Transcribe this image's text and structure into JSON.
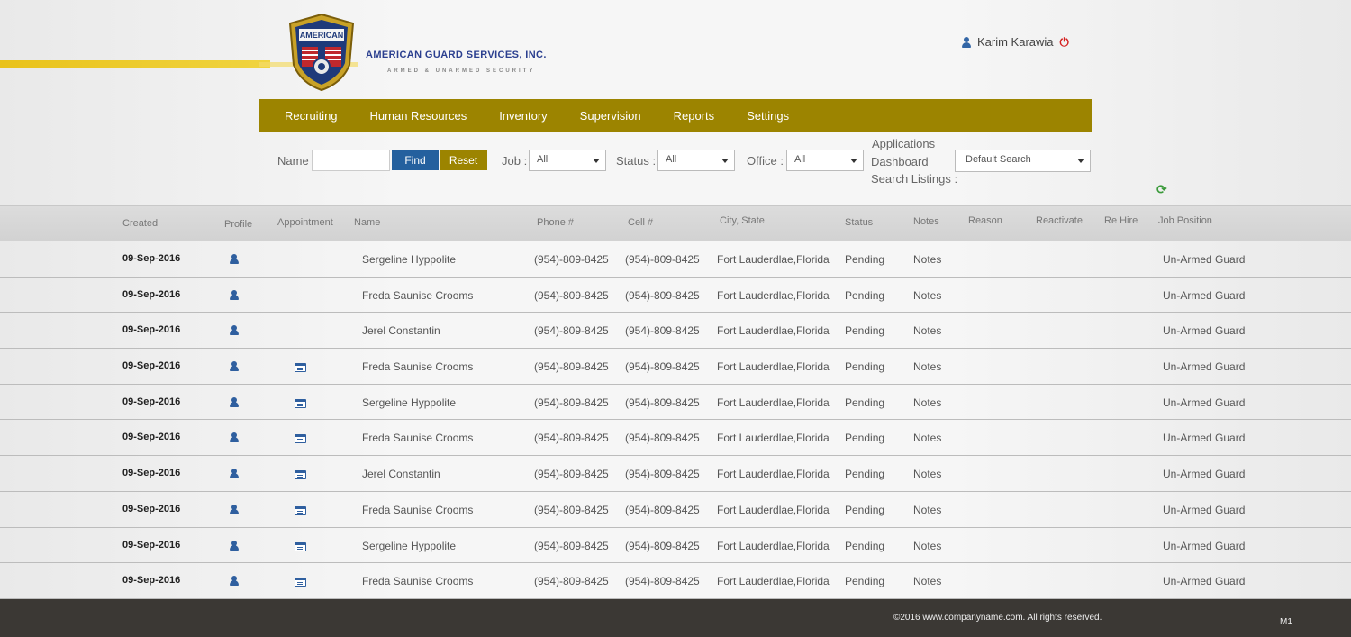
{
  "header": {
    "company_name": "AMERICAN GUARD SERVICES, INC.",
    "company_tagline": "ARMED & UNARMED SECURITY",
    "logo_text": "AMERICAN",
    "user_name": "Karim Karawia"
  },
  "nav": {
    "items": [
      "Recruiting",
      "Human Resources",
      "Inventory",
      "Supervision",
      "Reports",
      "Settings"
    ]
  },
  "filters": {
    "name_label": "Name",
    "name_value": "",
    "find_label": "Find",
    "reset_label": "Reset",
    "job_label": "Job :",
    "job_value": "All",
    "status_label": "Status :",
    "status_value": "All",
    "office_label": "Office :",
    "office_value": "All",
    "apps_label_1": "Applications",
    "apps_label_2": "Dashboard",
    "apps_label_3": "Search Listings :",
    "search_value": "Default Search"
  },
  "table": {
    "headers": [
      "Created",
      "Profile",
      "Appointment",
      "Name",
      "Phone #",
      "Cell #",
      "City, State",
      "Status",
      "Notes",
      "Reason",
      "Reactivate",
      "Re Hire",
      "Job Position"
    ],
    "rows": [
      {
        "created": "09-Sep-2016",
        "appointment": false,
        "name": "Sergeline Hyppolite",
        "phone": "(954)-809-8425",
        "cell": "(954)-809-8425",
        "city": "Fort Lauderdlae,Florida",
        "status": "Pending",
        "notes": "Notes",
        "job": "Un-Armed Guard"
      },
      {
        "created": "09-Sep-2016",
        "appointment": false,
        "name": "Freda Saunise Crooms",
        "phone": "(954)-809-8425",
        "cell": "(954)-809-8425",
        "city": "Fort Lauderdlae,Florida",
        "status": "Pending",
        "notes": "Notes",
        "job": "Un-Armed Guard"
      },
      {
        "created": "09-Sep-2016",
        "appointment": false,
        "name": "Jerel Constantin",
        "phone": "(954)-809-8425",
        "cell": "(954)-809-8425",
        "city": "Fort Lauderdlae,Florida",
        "status": "Pending",
        "notes": "Notes",
        "job": "Un-Armed Guard"
      },
      {
        "created": "09-Sep-2016",
        "appointment": true,
        "name": "Freda Saunise Crooms",
        "phone": "(954)-809-8425",
        "cell": "(954)-809-8425",
        "city": "Fort Lauderdlae,Florida",
        "status": "Pending",
        "notes": "Notes",
        "job": "Un-Armed Guard"
      },
      {
        "created": "09-Sep-2016",
        "appointment": true,
        "name": "Sergeline Hyppolite",
        "phone": "(954)-809-8425",
        "cell": "(954)-809-8425",
        "city": "Fort Lauderdlae,Florida",
        "status": "Pending",
        "notes": "Notes",
        "job": "Un-Armed Guard"
      },
      {
        "created": "09-Sep-2016",
        "appointment": true,
        "name": "Freda Saunise Crooms",
        "phone": "(954)-809-8425",
        "cell": "(954)-809-8425",
        "city": "Fort Lauderdlae,Florida",
        "status": "Pending",
        "notes": "Notes",
        "job": "Un-Armed Guard"
      },
      {
        "created": "09-Sep-2016",
        "appointment": true,
        "name": "Jerel Constantin",
        "phone": "(954)-809-8425",
        "cell": "(954)-809-8425",
        "city": "Fort Lauderdlae,Florida",
        "status": "Pending",
        "notes": "Notes",
        "job": "Un-Armed Guard"
      },
      {
        "created": "09-Sep-2016",
        "appointment": true,
        "name": "Freda Saunise Crooms",
        "phone": "(954)-809-8425",
        "cell": "(954)-809-8425",
        "city": "Fort Lauderdlae,Florida",
        "status": "Pending",
        "notes": "Notes",
        "job": "Un-Armed Guard"
      },
      {
        "created": "09-Sep-2016",
        "appointment": true,
        "name": "Sergeline Hyppolite",
        "phone": "(954)-809-8425",
        "cell": "(954)-809-8425",
        "city": "Fort Lauderdlae,Florida",
        "status": "Pending",
        "notes": "Notes",
        "job": "Un-Armed Guard"
      },
      {
        "created": "09-Sep-2016",
        "appointment": true,
        "name": "Freda Saunise Crooms",
        "phone": "(954)-809-8425",
        "cell": "(954)-809-8425",
        "city": "Fort Lauderdlae,Florida",
        "status": "Pending",
        "notes": "Notes",
        "job": "Un-Armed Guard"
      }
    ]
  },
  "footer": {
    "copyright": "©2016 www.companyname.com. All rights reserved.",
    "version": "M1"
  },
  "colors": {
    "nav_gold": "#9c8400",
    "find_blue": "#24609e",
    "icon_blue": "#2f5f9f",
    "footer_bg": "#3b3834"
  }
}
